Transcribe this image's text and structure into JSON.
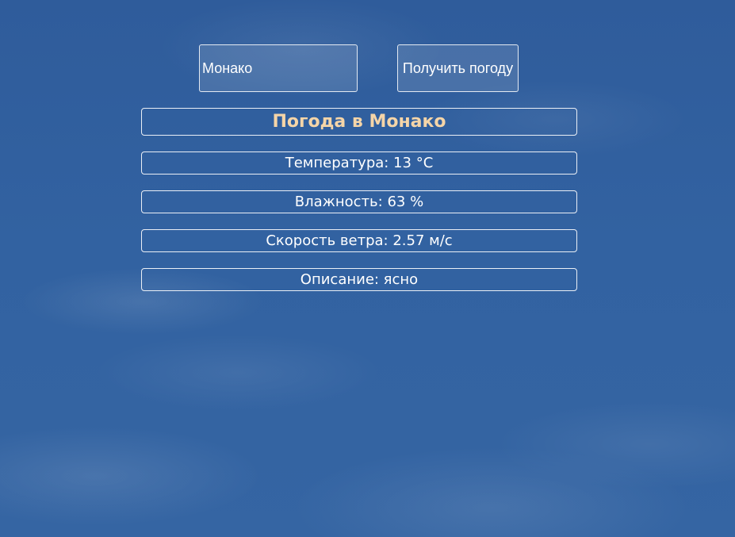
{
  "search": {
    "city_value": "Монако",
    "button_label": "Получить погоду"
  },
  "weather": {
    "title": "Погода в Монако",
    "temperature": "Температура: 13 °C",
    "humidity": "Влажность: 63 %",
    "wind": "Скорость ветра: 2.57 м/с",
    "description": "Описание: ясно"
  },
  "colors": {
    "background": "#3262a1",
    "title_text": "#f5d5a8",
    "text": "#ffffff",
    "border": "#ffffff"
  }
}
